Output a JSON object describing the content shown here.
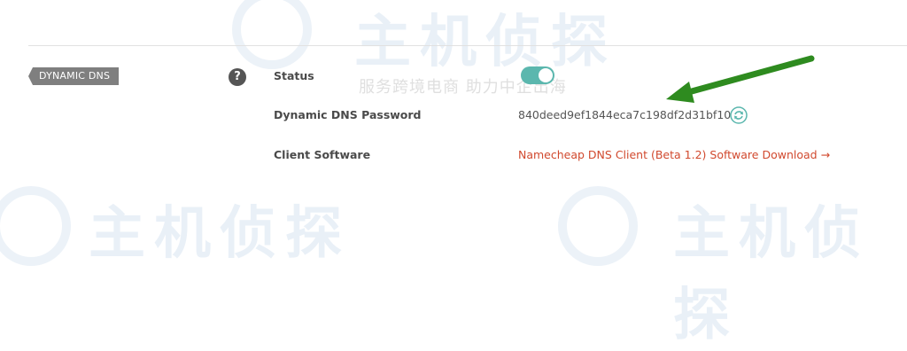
{
  "section": {
    "tag": "DYNAMIC DNS",
    "help_icon": "?"
  },
  "fields": {
    "status_label": "Status",
    "status_enabled": true,
    "password_label": "Dynamic DNS Password",
    "password_value": "840deed9ef1844eca7c198df2d31bf10",
    "client_label": "Client Software",
    "client_link": "Namecheap DNS Client (Beta 1.2) Software Download →"
  },
  "watermark": {
    "main_top": "主机侦探",
    "sub": "服务跨境电商 助力中企出海",
    "main_bottom_left": "主机侦探",
    "main_bottom_right": "主机侦探"
  },
  "colors": {
    "toggle_on": "#5bb7ae",
    "link": "#d1492e",
    "arrow": "#2e8b1f",
    "refresh": "#5bb7ae"
  },
  "icons": {
    "refresh": "refresh-icon",
    "help": "question-icon",
    "arrow": "annotation-arrow"
  }
}
